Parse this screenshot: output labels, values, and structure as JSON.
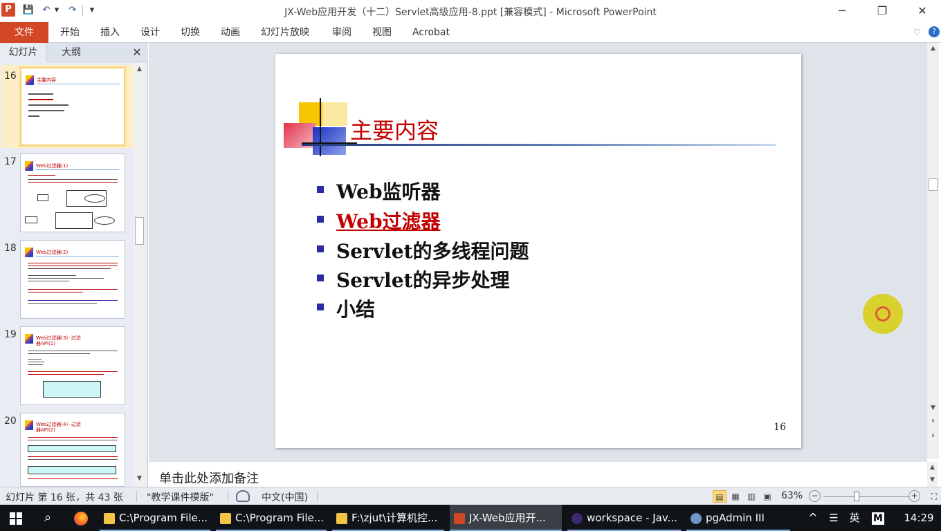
{
  "window": {
    "title": "JX-Web应用开发（十二）Servlet高级应用-8.ppt [兼容模式] - Microsoft PowerPoint",
    "minimize": "─",
    "restore": "❐",
    "close": "✕"
  },
  "quick_access": {
    "app_icon": "P",
    "save_icon": "💾",
    "undo_icon": "↶",
    "redo_icon": "↷",
    "dropdown_icon": "▾"
  },
  "ribbon": {
    "file_tab": "文件",
    "tabs": [
      "开始",
      "插入",
      "设计",
      "切换",
      "动画",
      "幻灯片放映",
      "审阅",
      "视图",
      "Acrobat"
    ],
    "collapse_icon": "♡",
    "help_icon": "?"
  },
  "left_pane": {
    "tab_slides": "幻灯片",
    "tab_outline": "大纲",
    "close_icon": "✕",
    "thumbnails": [
      {
        "num": "16",
        "title": "主要内容"
      },
      {
        "num": "17",
        "title": "Web过滤器(1)"
      },
      {
        "num": "18",
        "title": "Web过滤器(2)"
      },
      {
        "num": "19",
        "title": "Web过滤器(3) -过滤器API(1)"
      },
      {
        "num": "20",
        "title": "Web过滤器(4) -过滤器API(2)"
      }
    ]
  },
  "slide": {
    "title": "主要内容",
    "bullets": [
      "Web监听器",
      "Web过滤器",
      "Servlet的多线程问题",
      "Servlet的异步处理",
      "小结"
    ],
    "page_number": "16"
  },
  "notes": {
    "placeholder": "单击此处添加备注"
  },
  "status_bar": {
    "slide_info": "幻灯片 第 16 张，共 43 张",
    "theme": "\"教学课件模版\"",
    "language": "中文(中国)",
    "zoom": "63%",
    "zoom_minus": "−",
    "zoom_plus": "+",
    "zoom_level": 0.38
  },
  "taskbar": {
    "items": [
      {
        "label": "C:\\Program File..."
      },
      {
        "label": "C:\\Program File..."
      },
      {
        "label": "F:\\zjut\\计算机控..."
      },
      {
        "label": "JX-Web应用开..."
      },
      {
        "label": "workspace - Jav..."
      },
      {
        "label": "pgAdmin III"
      }
    ],
    "ime": "英",
    "time": "14:29",
    "tray_up_icon": "^",
    "notify_icon": "☰"
  }
}
